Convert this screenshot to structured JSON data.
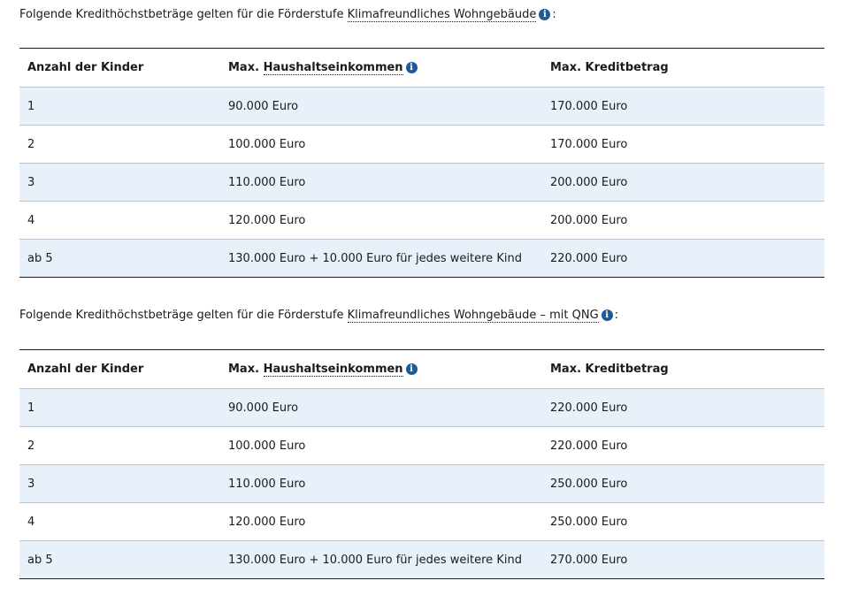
{
  "info_icon_glyph": "i",
  "info_icon_color": "#1f5a96",
  "row_shade_color": "#e8f1f9",
  "sections": [
    {
      "intro_prefix": "Folgende Kredithöchstbeträge gelten für die Förderstufe ",
      "intro_term": "Klimafreundliches Wohngebäude",
      "intro_suffix": ":",
      "headers": {
        "children": "Anzahl der Kinder",
        "income_prefix": "Max. ",
        "income_term": "Haushaltseinkommen",
        "credit": "Max. Kreditbetrag"
      },
      "rows": [
        {
          "children": "1",
          "income": "90.000 Euro",
          "credit": "170.000 Euro"
        },
        {
          "children": "2",
          "income": "100.000 Euro",
          "credit": "170.000 Euro"
        },
        {
          "children": "3",
          "income": "110.000 Euro",
          "credit": "200.000 Euro"
        },
        {
          "children": "4",
          "income": "120.000 Euro",
          "credit": "200.000 Euro"
        },
        {
          "children": "ab 5",
          "income": "130.000 Euro + 10.000 Euro für jedes weitere Kind",
          "credit": "220.000 Euro"
        }
      ]
    },
    {
      "intro_prefix": "Folgende Kredithöchstbeträge gelten für die Förderstufe ",
      "intro_term": "Klimafreundliches Wohngebäude – mit QNG",
      "intro_suffix": ":",
      "headers": {
        "children": "Anzahl der Kinder",
        "income_prefix": "Max. ",
        "income_term": "Haushaltseinkommen",
        "credit": "Max. Kreditbetrag"
      },
      "rows": [
        {
          "children": "1",
          "income": "90.000 Euro",
          "credit": "220.000 Euro"
        },
        {
          "children": "2",
          "income": "100.000 Euro",
          "credit": "220.000 Euro"
        },
        {
          "children": "3",
          "income": "110.000 Euro",
          "credit": "250.000 Euro"
        },
        {
          "children": "4",
          "income": "120.000 Euro",
          "credit": "250.000 Euro"
        },
        {
          "children": "ab 5",
          "income": "130.000 Euro + 10.000 Euro für jedes weitere Kind",
          "credit": "270.000 Euro"
        }
      ]
    }
  ]
}
